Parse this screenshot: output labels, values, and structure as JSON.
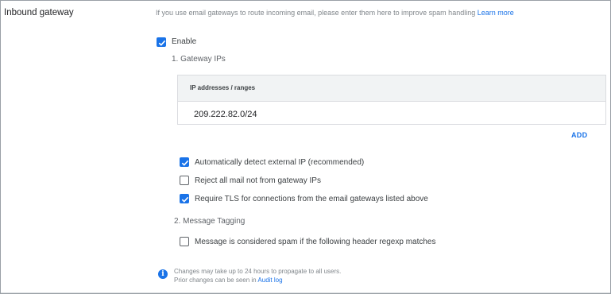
{
  "section": {
    "title": "Inbound gateway",
    "description": "If you use email gateways to route incoming email, please enter them here to improve spam handling",
    "learn_more": "Learn more"
  },
  "enable": {
    "label": "Enable",
    "checked": true
  },
  "gateway_ips": {
    "heading": "1. Gateway IPs",
    "column_header": "IP addresses / ranges",
    "rows": [
      "209.222.82.0/24"
    ],
    "add_label": "ADD"
  },
  "options": [
    {
      "label": "Automatically detect external IP (recommended)",
      "checked": true
    },
    {
      "label": "Reject all mail not from gateway IPs",
      "checked": false
    },
    {
      "label": "Require TLS for connections from the email gateways listed above",
      "checked": true
    }
  ],
  "message_tagging": {
    "heading": "2. Message Tagging",
    "option": {
      "label": "Message is considered spam if the following header regexp matches",
      "checked": false
    }
  },
  "footer": {
    "info_icon": "info-icon",
    "line1": "Changes may take up to 24 hours to propagate to all users.",
    "line2_prefix": "Prior changes can be seen in",
    "audit_log": "Audit log"
  },
  "colors": {
    "accent": "#1a73e8",
    "text": "#202124",
    "muted": "#80868b"
  }
}
